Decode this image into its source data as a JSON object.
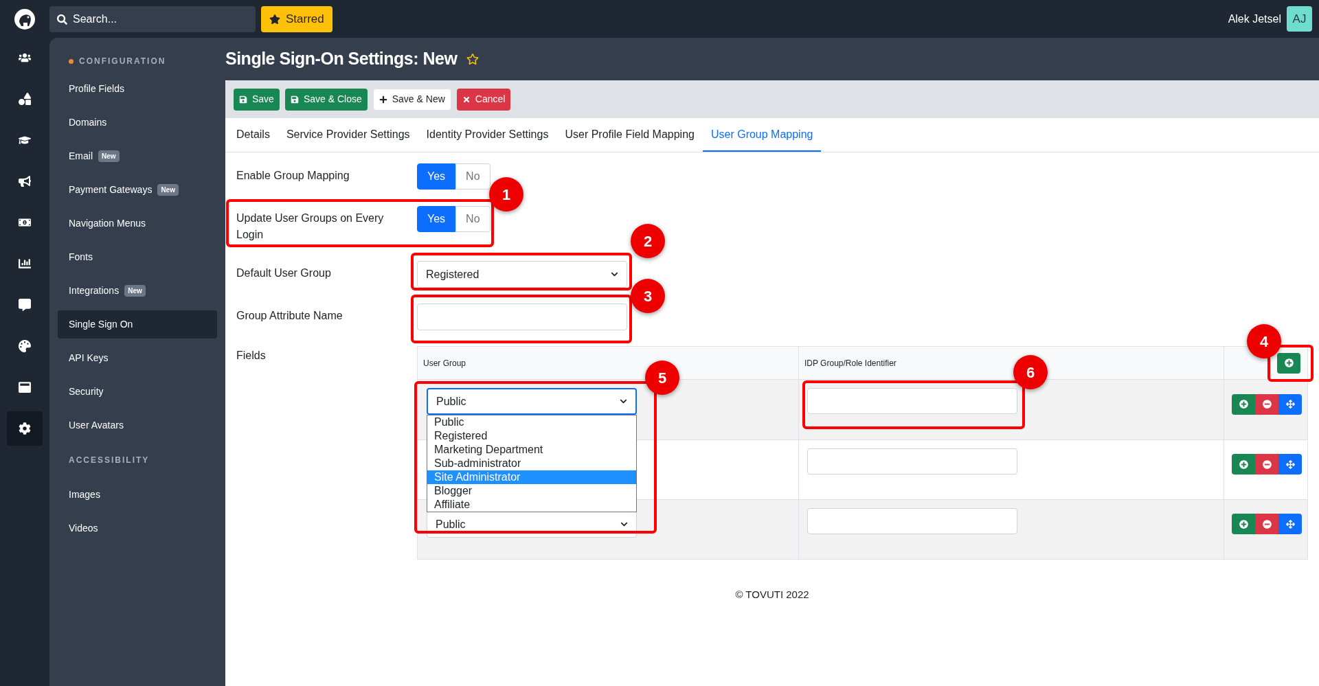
{
  "topbar": {
    "search": {
      "placeholder": "Search..."
    },
    "starred": "Starred",
    "user": {
      "name": "Alek Jetsel",
      "initials": "AJ"
    }
  },
  "rail": [
    {
      "selected": false
    },
    {
      "selected": false
    },
    {
      "selected": false
    },
    {
      "selected": false
    },
    {
      "selected": false
    },
    {
      "selected": false
    },
    {
      "selected": false
    },
    {
      "selected": false
    },
    {
      "selected": false
    },
    {
      "selected": true
    }
  ],
  "sidebar": {
    "sections": [
      {
        "title": "CONFIGURATION",
        "marked": true,
        "items": [
          {
            "label": "Profile Fields",
            "selected": false
          },
          {
            "label": "Domains",
            "selected": false
          },
          {
            "label": "Email",
            "badge": "New",
            "selected": false
          },
          {
            "label": "Payment Gateways",
            "badge": "New",
            "selected": false
          },
          {
            "label": "Navigation Menus",
            "selected": false
          },
          {
            "label": "Fonts",
            "selected": false
          },
          {
            "label": "Integrations",
            "badge": "New",
            "selected": false
          },
          {
            "label": "Single Sign On",
            "selected": true
          },
          {
            "label": "API Keys",
            "selected": false
          },
          {
            "label": "Security",
            "selected": false
          },
          {
            "label": "User Avatars",
            "selected": false
          }
        ]
      },
      {
        "title": "ACCESSIBILITY",
        "items": [
          {
            "label": "Images",
            "selected": false
          },
          {
            "label": "Videos",
            "selected": false
          }
        ]
      }
    ]
  },
  "page": {
    "title": "Single Sign-On Settings: New",
    "starred": false
  },
  "toolbar": [
    {
      "label": "Save",
      "kind": "save"
    },
    {
      "label": "Save & Close",
      "kind": "save"
    },
    {
      "label": "Save & New",
      "kind": "new"
    },
    {
      "label": "Cancel",
      "kind": "cancel"
    }
  ],
  "tabs": [
    {
      "label": "Details",
      "selected": false
    },
    {
      "label": "Service Provider Settings",
      "selected": false
    },
    {
      "label": "Identity Provider Settings",
      "selected": false
    },
    {
      "label": "User Profile Field Mapping",
      "selected": false
    },
    {
      "label": "User Group Mapping",
      "selected": true
    }
  ],
  "form": [
    {
      "kind": "toggle",
      "label": "Enable Group Mapping",
      "options": [
        {
          "label": "Yes",
          "selected": true
        },
        {
          "label": "No",
          "selected": false
        }
      ]
    },
    {
      "kind": "toggle",
      "label": "Update User Groups on Every Login",
      "options": [
        {
          "label": "Yes",
          "selected": true
        },
        {
          "label": "No",
          "selected": false
        }
      ]
    },
    {
      "kind": "select",
      "label": "Default User Group",
      "value": "Registered"
    },
    {
      "kind": "text",
      "label": "Group Attribute Name"
    }
  ],
  "fields": {
    "label": "Fields",
    "columns": [
      "User Group",
      "IDP Group/Role Identifier"
    ],
    "rows": [
      {
        "user_group": "Public",
        "open": true
      },
      {},
      {
        "user_group": "Public"
      }
    ],
    "dropdown": [
      {
        "label": "Public",
        "selected": false
      },
      {
        "label": "Registered",
        "selected": false
      },
      {
        "label": "Marketing Department",
        "selected": false
      },
      {
        "label": "Sub-administrator",
        "selected": false
      },
      {
        "label": "Site Administrator",
        "selected": true
      },
      {
        "label": "Blogger",
        "selected": false
      },
      {
        "label": "Affiliate",
        "selected": false
      }
    ]
  },
  "footer": "© TOVUTI 2022",
  "annotations": [
    {
      "label": "1"
    },
    {
      "label": "2"
    },
    {
      "label": "3"
    },
    {
      "label": "4"
    },
    {
      "label": "5"
    },
    {
      "label": "6"
    }
  ]
}
